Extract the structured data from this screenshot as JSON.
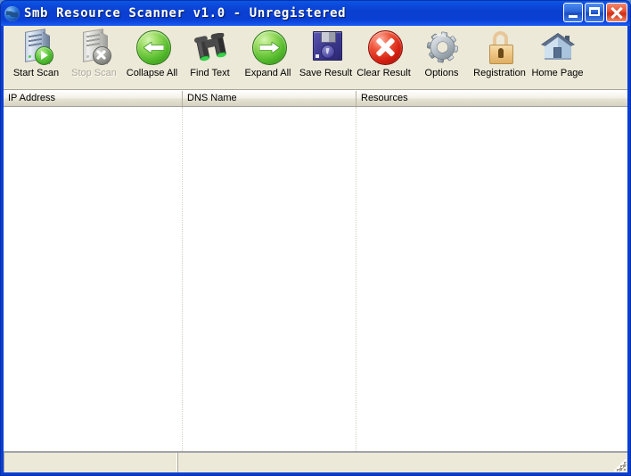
{
  "window": {
    "title": "Smb Resource Scanner v1.0 - Unregistered",
    "icon": "globe-icon",
    "titlebar_color": "#0a3fd4",
    "client_color": "#ece9d8",
    "controls": {
      "minimize": "Minimize",
      "maximize": "Maximize",
      "close": "Close"
    }
  },
  "toolbar": {
    "buttons": [
      {
        "label": "Start Scan",
        "icon": "server-play-icon",
        "enabled": true
      },
      {
        "label": "Stop Scan",
        "icon": "server-stop-icon",
        "enabled": false
      },
      {
        "label": "Collapse All",
        "icon": "arrow-left-circle-icon",
        "enabled": true
      },
      {
        "label": "Find Text",
        "icon": "binoculars-icon",
        "enabled": true
      },
      {
        "label": "Expand All",
        "icon": "arrow-right-circle-icon",
        "enabled": true
      },
      {
        "label": "Save Result",
        "icon": "floppy-disk-icon",
        "enabled": true
      },
      {
        "label": "Clear Result",
        "icon": "red-x-circle-icon",
        "enabled": true
      },
      {
        "label": "Options",
        "icon": "gear-icon",
        "enabled": true
      },
      {
        "label": "Registration",
        "icon": "padlock-icon",
        "enabled": true
      },
      {
        "label": "Home Page",
        "icon": "house-icon",
        "enabled": true
      }
    ]
  },
  "list": {
    "columns": [
      {
        "label": "IP Address"
      },
      {
        "label": "DNS Name"
      },
      {
        "label": "Resources"
      }
    ],
    "rows": []
  },
  "statusbar": {
    "panels": [
      {
        "text": ""
      },
      {
        "text": ""
      }
    ],
    "grip": "resize-grip-icon"
  }
}
